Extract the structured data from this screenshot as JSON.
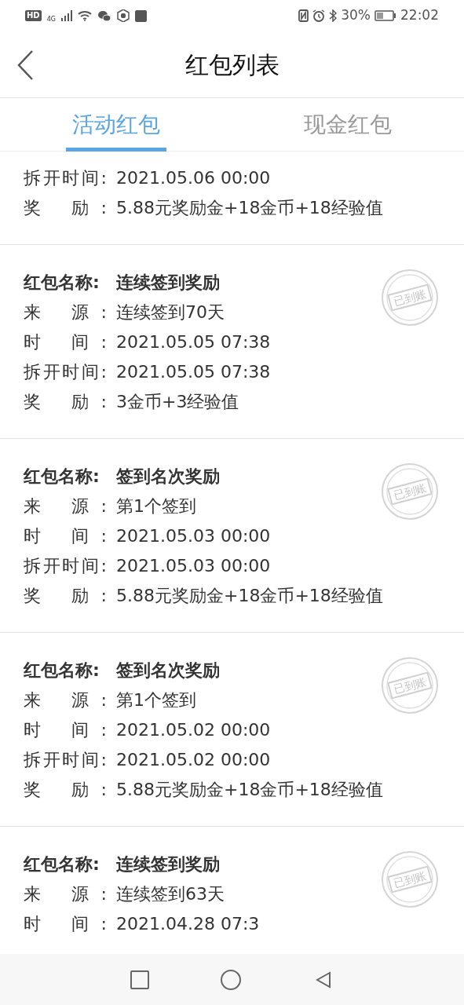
{
  "status_bar": {
    "left_badges": [
      "HD",
      "4G"
    ],
    "battery": "30%",
    "time": "22:02"
  },
  "header": {
    "title": "红包列表"
  },
  "tabs": [
    {
      "label": "活动红包",
      "selected": true
    },
    {
      "label": "现金红包",
      "selected": false
    }
  ],
  "cards": [
    {
      "rows": [
        {
          "kind": "field",
          "label": "拆开时间:",
          "value": "2021.05.06 00:00"
        },
        {
          "kind": "field",
          "label": "奖 励:",
          "value": "5.88元奖励金+18金币+18经验值"
        }
      ]
    },
    {
      "stamp": "已到账",
      "rows": [
        {
          "kind": "name",
          "label": "红包名称:",
          "value": "连续签到奖励"
        },
        {
          "kind": "field",
          "label": "来 源:",
          "value": "连续签到70天"
        },
        {
          "kind": "field",
          "label": "时 间:",
          "value": "2021.05.05 07:38"
        },
        {
          "kind": "field",
          "label": "拆开时间:",
          "value": "2021.05.05 07:38"
        },
        {
          "kind": "field",
          "label": "奖 励:",
          "value": "3金币+3经验值"
        }
      ]
    },
    {
      "stamp": "已到账",
      "rows": [
        {
          "kind": "name",
          "label": "红包名称:",
          "value": "签到名次奖励"
        },
        {
          "kind": "field",
          "label": "来 源:",
          "value": "第1个签到"
        },
        {
          "kind": "field",
          "label": "时 间:",
          "value": "2021.05.03 00:00"
        },
        {
          "kind": "field",
          "label": "拆开时间:",
          "value": "2021.05.03 00:00"
        },
        {
          "kind": "field",
          "label": "奖 励:",
          "value": "5.88元奖励金+18金币+18经验值"
        }
      ]
    },
    {
      "stamp": "已到账",
      "rows": [
        {
          "kind": "name",
          "label": "红包名称:",
          "value": "签到名次奖励"
        },
        {
          "kind": "field",
          "label": "来 源:",
          "value": "第1个签到"
        },
        {
          "kind": "field",
          "label": "时 间:",
          "value": "2021.05.02 00:00"
        },
        {
          "kind": "field",
          "label": "拆开时间:",
          "value": "2021.05.02 00:00"
        },
        {
          "kind": "field",
          "label": "奖 励:",
          "value": "5.88元奖励金+18金币+18经验值"
        }
      ]
    },
    {
      "stamp": "已到账",
      "rows": [
        {
          "kind": "name",
          "label": "红包名称:",
          "value": "连续签到奖励"
        },
        {
          "kind": "field",
          "label": "来 源:",
          "value": "连续签到63天"
        },
        {
          "kind": "field",
          "label": "时 间:",
          "value": "2021.04.28 07:3"
        }
      ]
    }
  ]
}
